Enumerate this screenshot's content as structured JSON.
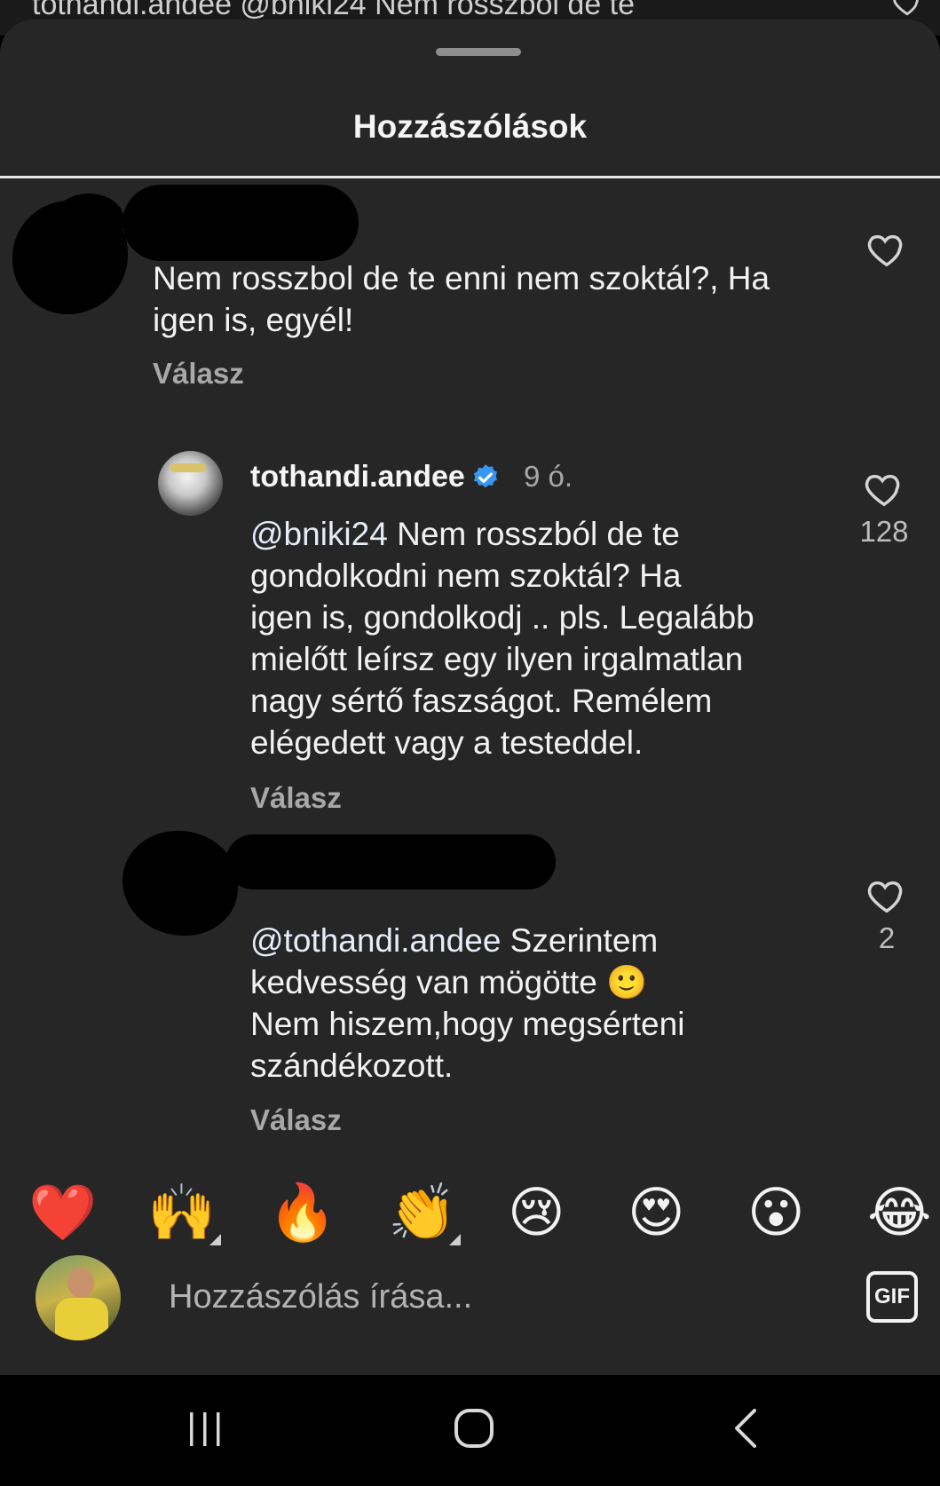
{
  "background_strip": {
    "text": "tothandi.andee @bniki24 Nem rosszból de te"
  },
  "sheet": {
    "title": "Hozzászólások"
  },
  "comments": [
    {
      "author_redacted": true,
      "text": "Nem rosszbol de te enni nem szoktál?, Ha igen is, egyél!",
      "text_lines": [
        "Nem rosszbol de te enni nem szoktál?, Ha",
        "igen is, egyél!"
      ],
      "reply_label": "Válasz",
      "likes": ""
    },
    {
      "username": "tothandi.andee",
      "verified": true,
      "time": "9 ó.",
      "mention": "@bniki24",
      "text_lines": [
        " Nem rosszból de te",
        "gondolkodni nem szoktál? Ha",
        "igen is, gondolkodj .. pls. Legalább",
        "mielőtt leírsz egy ilyen irgalmatlan",
        "nagy sértő faszságot. Remélem",
        "elégedett vagy a testeddel."
      ],
      "reply_label": "Válasz",
      "likes": "128"
    },
    {
      "author_redacted": true,
      "mention": "@tothandi.andee",
      "text_lines": [
        " Szerintem",
        "kedvesség van mögötte 🙂",
        "Nem hiszem,hogy megsérteni",
        "szándékozott."
      ],
      "reply_label": "Válasz",
      "likes": "2"
    }
  ],
  "quick_reactions": [
    "❤️",
    "🙌",
    "🔥",
    "👏",
    "😢",
    "😍",
    "😮",
    "😂"
  ],
  "composer": {
    "placeholder": "Hozzászólás írása...",
    "gif_label": "GIF"
  },
  "colors": {
    "sheet_bg": "#262626",
    "verified": "#3897f0",
    "secondary_text": "#a8a8a8"
  }
}
